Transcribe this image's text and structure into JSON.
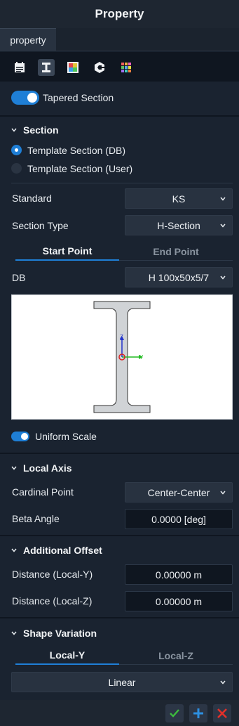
{
  "window": {
    "title": "Property"
  },
  "tabs": [
    {
      "label": "property"
    }
  ],
  "toolbar": {
    "icons": [
      "calendar-icon",
      "i-beam-icon",
      "color-map-icon",
      "section-c-icon",
      "color-grid-icon"
    ],
    "active": 1
  },
  "tapered": {
    "label": "Tapered Section",
    "enabled": true
  },
  "section": {
    "title": "Section",
    "radio_db": "Template Section (DB)",
    "radio_user": "Template Section (User)",
    "selected": "db",
    "standard_label": "Standard",
    "standard_value": "KS",
    "type_label": "Section Type",
    "type_value": "H-Section",
    "subtabs": [
      "Start Point",
      "End Point"
    ],
    "active_subtab": 0,
    "db_label": "DB",
    "db_value": "H 100x50x5/7",
    "uniform_scale_label": "Uniform Scale",
    "uniform_scale": true,
    "axis_y_label": "Y",
    "axis_z_label": "Z"
  },
  "local_axis": {
    "title": "Local Axis",
    "cardinal_label": "Cardinal Point",
    "cardinal_value": "Center-Center",
    "beta_label": "Beta Angle",
    "beta_value": "0.0000 [deg]"
  },
  "offset": {
    "title": "Additional Offset",
    "y_label": "Distance (Local-Y)",
    "y_value": "0.00000 m",
    "z_label": "Distance (Local-Z)",
    "z_value": "0.00000 m"
  },
  "shape_variation": {
    "title": "Shape Variation",
    "subtabs": [
      "Local-Y",
      "Local-Z"
    ],
    "active_subtab": 0,
    "value": "Linear"
  },
  "footer": {
    "buttons": [
      "apply-check",
      "add-plus",
      "close-x"
    ]
  },
  "colors": {
    "accent": "#1f7fd6",
    "ok": "#3dbb3d",
    "plus": "#2d8fe0",
    "cancel": "#e0302a"
  }
}
